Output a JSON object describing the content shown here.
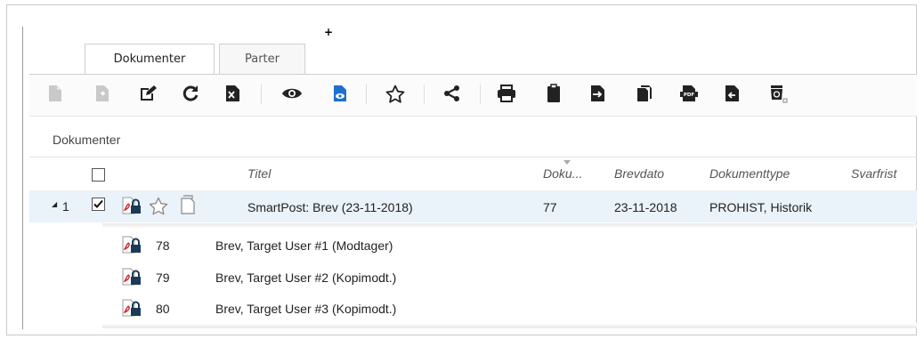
{
  "cursor_glyph": "+",
  "tabs": [
    {
      "label": "Dokumenter",
      "active": true
    },
    {
      "label": "Parter",
      "active": false
    }
  ],
  "toolbar_icons": [
    "new-document-icon",
    "new-document-disabled-icon",
    "edit-icon",
    "refresh-icon",
    "excel-export-icon",
    "view-icon",
    "preview-document-icon",
    "favorite-star-icon",
    "share-icon",
    "print-icon",
    "clipboard-icon",
    "move-document-icon",
    "copy-icon",
    "pdf-icon",
    "restore-icon",
    "recycle-bin-icon"
  ],
  "section_title": "Dokumenter",
  "columns": {
    "titel": "Titel",
    "doku": "Doku...",
    "brevdato": "Brevdato",
    "dokumenttype": "Dokumenttype",
    "svarfrist": "Svarfrist"
  },
  "row": {
    "expander": "◢",
    "number": "1",
    "checked": true,
    "title": "SmartPost: Brev (23-11-2018)",
    "doku": "77",
    "brevdato": "23-11-2018",
    "dokumenttype": "PROHIST, Historik"
  },
  "sub_rows": [
    {
      "number": "78",
      "title": "Brev, Target User #1 (Modtager)"
    },
    {
      "number": "79",
      "title": "Brev, Target User #2 (Kopimodt.)"
    },
    {
      "number": "80",
      "title": "Brev, Target User #3 (Kopimodt.)"
    }
  ],
  "colors": {
    "accent": "#1f6fd0",
    "selected_row": "#eaf2fa",
    "pdf_red": "#d0222b",
    "icon_dark": "#222222"
  }
}
